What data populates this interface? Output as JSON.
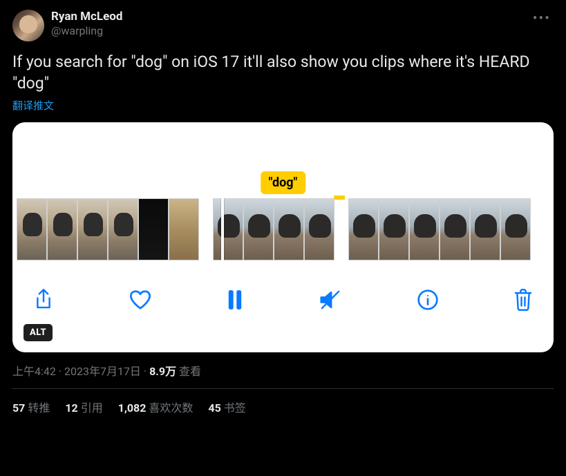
{
  "author": {
    "name": "Ryan McLeod",
    "handle": "@warpling"
  },
  "tweet_text": "If you search for \"dog\" on iOS 17 it'll also show you clips where it's HEARD \"dog\"",
  "translate_label": "翻译推文",
  "media": {
    "badge_text": "\"dog\"",
    "alt_badge": "ALT",
    "icons": {
      "share": "share-icon",
      "heart": "heart-icon",
      "pause": "pause-icon",
      "mute": "volume-mute-icon",
      "info": "info-icon",
      "trash": "trash-icon"
    }
  },
  "meta": {
    "time": "上午4:42",
    "date": "2023年7月17日",
    "views_count": "8.9万",
    "views_label": "查看",
    "separator": " · "
  },
  "stats": {
    "retweets": {
      "count": "57",
      "label": "转推"
    },
    "quotes": {
      "count": "12",
      "label": "引用"
    },
    "likes": {
      "count": "1,082",
      "label": "喜欢次数"
    },
    "bookmarks": {
      "count": "45",
      "label": "书签"
    }
  }
}
